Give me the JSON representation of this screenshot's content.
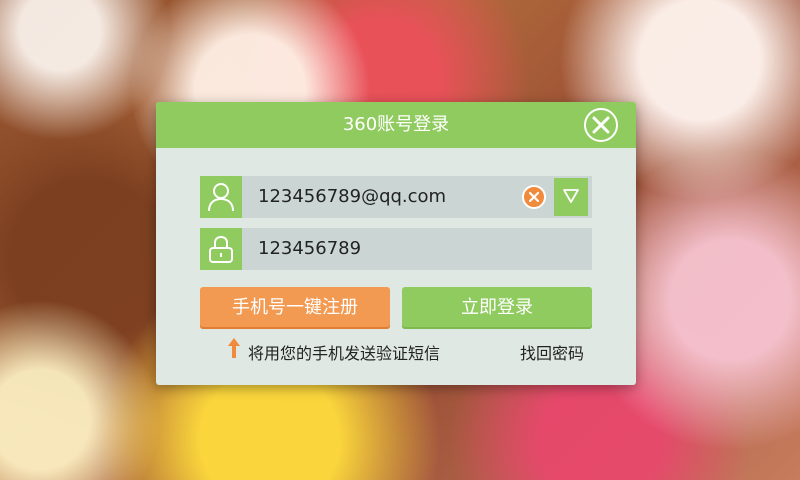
{
  "dialog": {
    "title": "360账号登录",
    "username_value": "123456789@qq.com",
    "password_value": "123456789",
    "register_button_label": "手机号一键注册",
    "login_button_label": "立即登录",
    "sms_hint": "将用您的手机发送验证短信",
    "forgot_password_label": "找回密码"
  },
  "icons": {
    "close": "close-icon",
    "user": "user-icon",
    "lock": "lock-icon",
    "clear": "clear-icon",
    "dropdown": "chevron-down-icon",
    "hint_arrow": "arrow-up-icon"
  },
  "colors": {
    "accent_green": "#90cb5f",
    "accent_orange": "#f39a52",
    "dialog_bg": "#dfe8e3",
    "field_bg": "#cbd6d4"
  }
}
